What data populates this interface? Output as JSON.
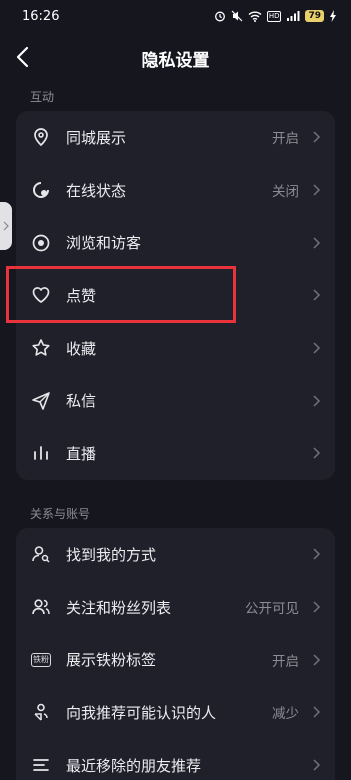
{
  "status_bar": {
    "time": "16:26",
    "hd_label": "HD",
    "battery": "79"
  },
  "header": {
    "title": "隐私设置"
  },
  "sections": [
    {
      "title": "互动",
      "items": [
        {
          "label": "同城展示",
          "value": "开启",
          "icon": "location-pin-icon"
        },
        {
          "label": "在线状态",
          "value": "关闭",
          "icon": "online-status-icon"
        },
        {
          "label": "浏览和访客",
          "value": "",
          "icon": "eye-icon"
        },
        {
          "label": "点赞",
          "value": "",
          "icon": "heart-icon"
        },
        {
          "label": "收藏",
          "value": "",
          "icon": "star-icon"
        },
        {
          "label": "私信",
          "value": "",
          "icon": "send-icon"
        },
        {
          "label": "直播",
          "value": "",
          "icon": "live-bars-icon"
        }
      ]
    },
    {
      "title": "关系与账号",
      "items": [
        {
          "label": "找到我的方式",
          "value": "",
          "icon": "user-search-icon"
        },
        {
          "label": "关注和粉丝列表",
          "value": "公开可见",
          "icon": "users-icon"
        },
        {
          "label": "展示铁粉标签",
          "value": "开启",
          "icon": "fan-badge-icon",
          "badge_text": "铁粉"
        },
        {
          "label": "向我推荐可能认识的人",
          "value": "减少",
          "icon": "recommend-people-icon"
        },
        {
          "label": "最近移除的朋友推荐",
          "value": "",
          "icon": "list-icon"
        }
      ]
    }
  ]
}
